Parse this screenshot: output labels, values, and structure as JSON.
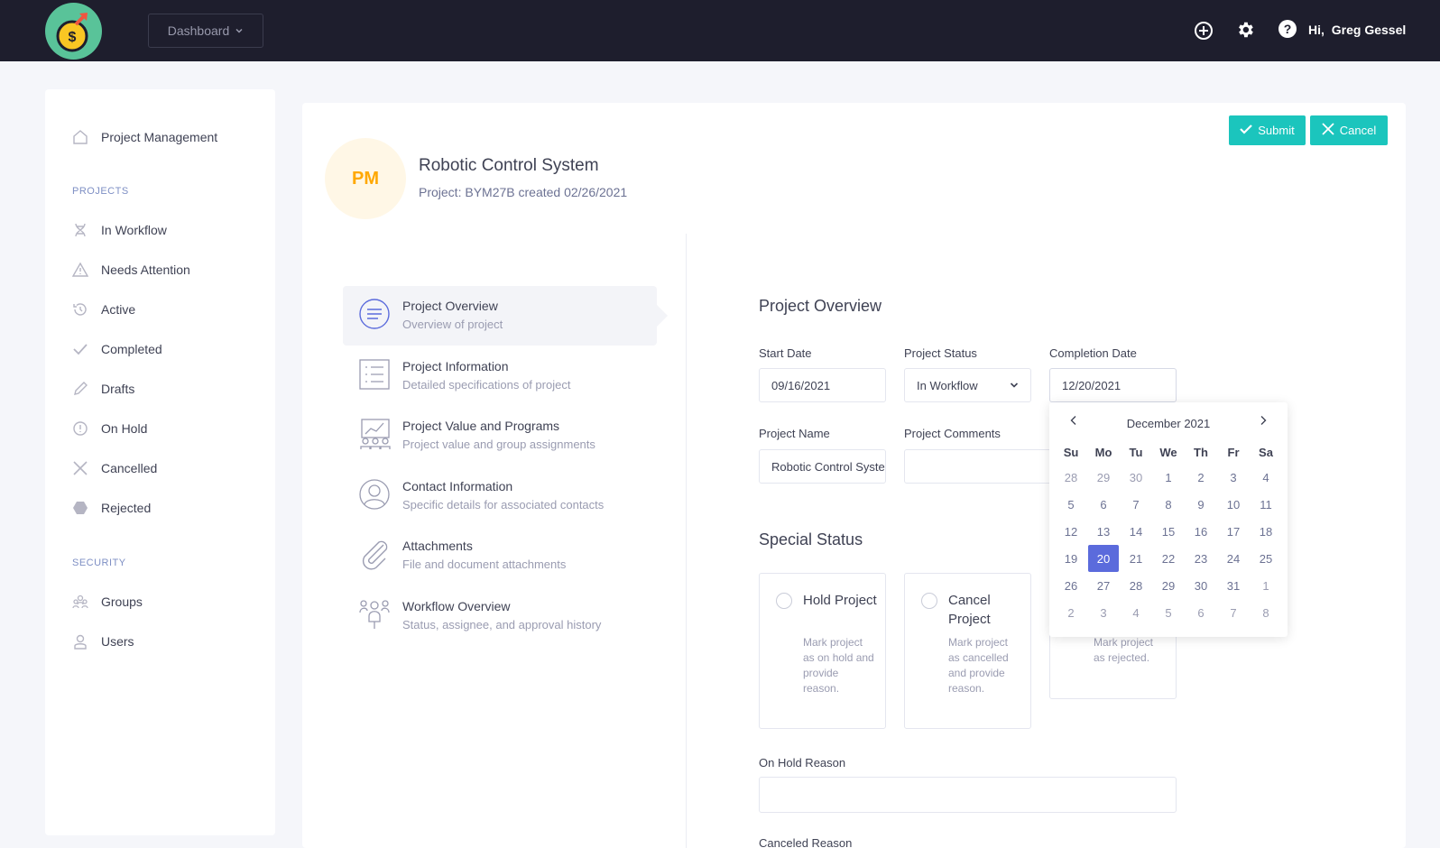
{
  "header": {
    "dashboard_label": "Dashboard",
    "greeting": "Hi,",
    "user_name": "Greg Gessel",
    "icons": [
      "plus-circle-icon",
      "gear-icon",
      "help-icon"
    ]
  },
  "sidebar": {
    "top_item": "Project Management",
    "projects_heading": "PROJECTS",
    "projects": [
      {
        "label": "In Workflow",
        "icon": "dna-icon"
      },
      {
        "label": "Needs Attention",
        "icon": "warning-icon"
      },
      {
        "label": "Active",
        "icon": "history-icon"
      },
      {
        "label": "Completed",
        "icon": "check-icon"
      },
      {
        "label": "Drafts",
        "icon": "pencil-icon"
      },
      {
        "label": "On Hold",
        "icon": "pause-circle-icon"
      },
      {
        "label": "Cancelled",
        "icon": "close-icon"
      },
      {
        "label": "Rejected",
        "icon": "hexagon-icon"
      }
    ],
    "security_heading": "SECURITY",
    "security": [
      {
        "label": "Groups",
        "icon": "group-icon"
      },
      {
        "label": "Users",
        "icon": "user-icon"
      }
    ]
  },
  "project": {
    "initials": "PM",
    "title": "Robotic Control System",
    "subtitle": "Project: BYM27B created 02/26/2021"
  },
  "actions": {
    "submit": "Submit",
    "cancel": "Cancel"
  },
  "steps": [
    {
      "title": "Project Overview",
      "desc": "Overview of project",
      "icon": "list-circle-icon"
    },
    {
      "title": "Project Information",
      "desc": "Detailed specifications of project",
      "icon": "checklist-icon"
    },
    {
      "title": "Project Value and Programs",
      "desc": "Project value and group assignments",
      "icon": "chart-people-icon"
    },
    {
      "title": "Contact Information",
      "desc": "Specific details for associated contacts",
      "icon": "user-circle-icon"
    },
    {
      "title": "Attachments",
      "desc": "File and document attachments",
      "icon": "paperclip-icon"
    },
    {
      "title": "Workflow Overview",
      "desc": "Status, assignee, and approval history",
      "icon": "workflow-icon"
    }
  ],
  "overview": {
    "heading": "Project Overview",
    "start_date_label": "Start Date",
    "start_date": "09/16/2021",
    "status_label": "Project Status",
    "status_value": "In Workflow",
    "completion_label": "Completion Date",
    "completion_date": "12/20/2021",
    "name_label": "Project Name",
    "name_value": "Robotic Control System",
    "comments_label": "Project Comments",
    "comments_value": ""
  },
  "special": {
    "heading": "Special Status",
    "cards": [
      {
        "title": "Hold Project",
        "desc": "Mark project as on hold and provide reason."
      },
      {
        "title": "Cancel Project",
        "desc": "Mark project as cancelled and provide reason."
      },
      {
        "title": "",
        "desc": "Mark project as rejected."
      }
    ],
    "hold_reason_label": "On Hold Reason",
    "cancel_reason_label": "Canceled Reason"
  },
  "calendar": {
    "month": "December 2021",
    "weekdays": [
      "Su",
      "Mo",
      "Tu",
      "We",
      "Th",
      "Fr",
      "Sa"
    ],
    "days": [
      [
        "28",
        "29",
        "30",
        "1",
        "2",
        "3",
        "4"
      ],
      [
        "5",
        "6",
        "7",
        "8",
        "9",
        "10",
        "11"
      ],
      [
        "12",
        "13",
        "14",
        "15",
        "16",
        "17",
        "18"
      ],
      [
        "19",
        "20",
        "21",
        "22",
        "23",
        "24",
        "25"
      ],
      [
        "26",
        "27",
        "28",
        "29",
        "30",
        "31",
        "1"
      ],
      [
        "2",
        "3",
        "4",
        "5",
        "6",
        "7",
        "8"
      ]
    ],
    "selected": "20",
    "colors": {
      "selected": "#5b6bdc",
      "accent": "#1bc5bd"
    }
  }
}
